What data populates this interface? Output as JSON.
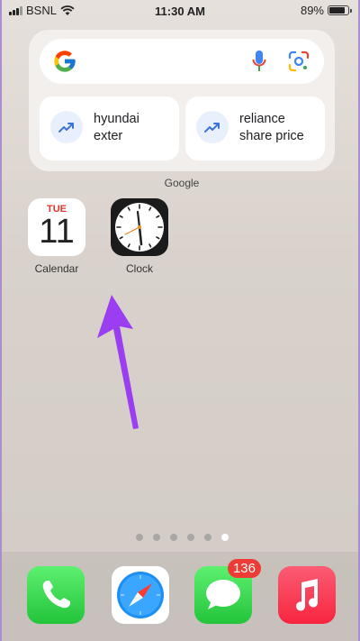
{
  "status_bar": {
    "carrier": "BSNL",
    "time": "11:30 AM",
    "battery_percent": "89%",
    "battery_level": 0.89,
    "icons": [
      "signal-icon",
      "wifi-icon",
      "battery-icon"
    ]
  },
  "google_widget": {
    "label": "Google",
    "search": {
      "value": "",
      "placeholder": ""
    },
    "icons": [
      "google-logo-icon",
      "mic-icon",
      "lens-icon",
      "trending-icon"
    ],
    "suggestions": [
      {
        "line1": "hyundai",
        "line2": "exter"
      },
      {
        "line1": "reliance",
        "line2": "share price"
      }
    ]
  },
  "home_apps": [
    {
      "name": "Calendar",
      "day": "TUE",
      "date": "11"
    },
    {
      "name": "Clock"
    }
  ],
  "annotation": {
    "color": "#9b3df0",
    "icon": "arrow-icon"
  },
  "page_dots": {
    "count": 6,
    "active_index": 5
  },
  "dock": {
    "apps": [
      "Phone",
      "Safari",
      "Messages",
      "Music"
    ],
    "messages_badge": "136"
  }
}
